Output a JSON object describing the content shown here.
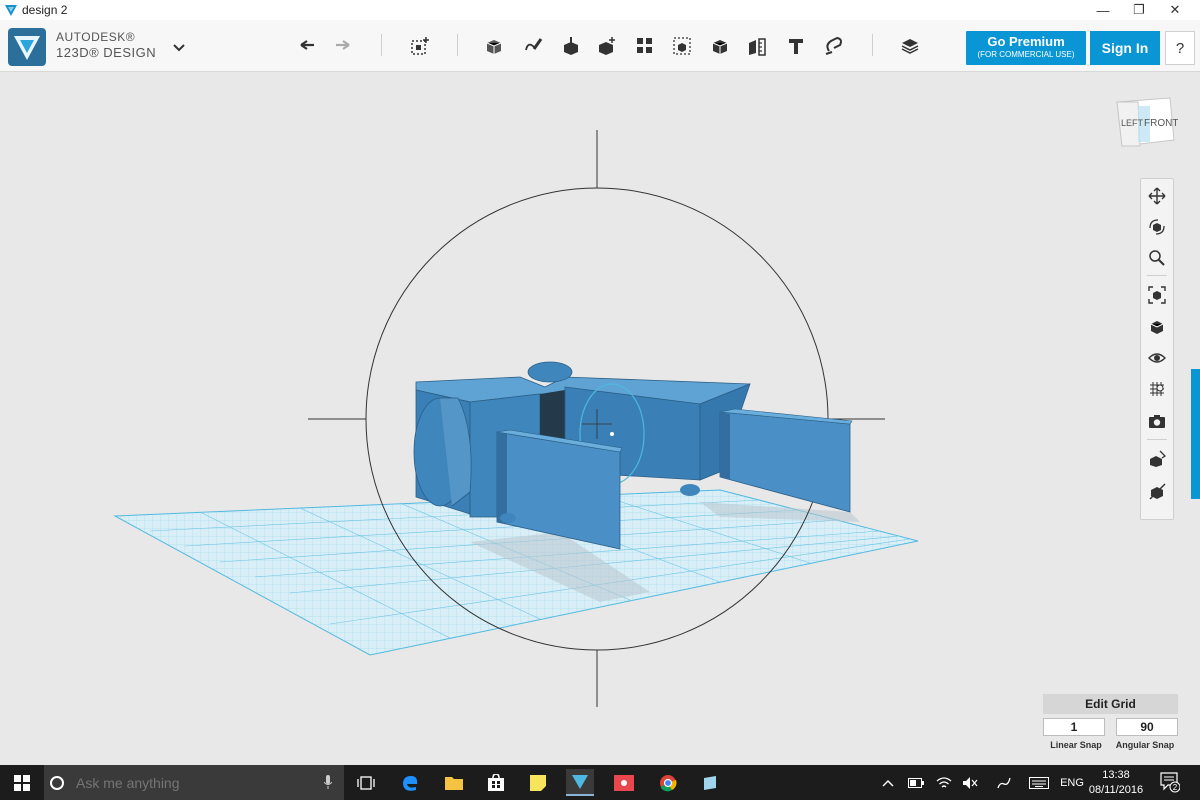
{
  "window": {
    "title": "design 2"
  },
  "brand": {
    "line1": "AUTODESK®",
    "line2": "123D® DESIGN"
  },
  "toolbar": {
    "undo_icon": "undo-icon",
    "redo_icon": "redo-icon",
    "primitives_icon": "primitives-icon",
    "sketch_icon": "sketch-icon",
    "construct_icon": "construct-icon",
    "modify_icon": "modify-icon",
    "pattern_icon": "pattern-icon",
    "group_icon": "group-icon",
    "combine_icon": "combine-icon",
    "measure_icon": "measure-icon",
    "text_icon": "text-icon",
    "snap_icon": "snap-icon",
    "materials_icon": "materials-icon"
  },
  "premium": {
    "label": "Go Premium",
    "sublabel": "(FOR COMMERCIAL USE)"
  },
  "signin": {
    "label": "Sign In"
  },
  "help": {
    "label": "?"
  },
  "viewcube": {
    "left": "LEFT",
    "front": "FRONT"
  },
  "nav_tools": [
    "pan-icon",
    "orbit-icon",
    "zoom-icon",
    "fit-icon",
    "view-mode-icon",
    "visibility-icon",
    "grid-visibility-icon",
    "snapshot-icon",
    "material-icon",
    "hide-icon"
  ],
  "edit_grid": {
    "button": "Edit Grid",
    "linear_snap": "1",
    "angular_snap": "90",
    "linear_label": "Linear Snap",
    "angular_label": "Angular Snap"
  },
  "taskbar": {
    "search_placeholder": "Ask me anything",
    "language": "ENG",
    "time": "13:38",
    "date": "08/11/2016",
    "notifications": "2"
  },
  "colors": {
    "accent": "#0a95d4",
    "model": "#3a7fb5",
    "grid": "#8fd2ec"
  }
}
